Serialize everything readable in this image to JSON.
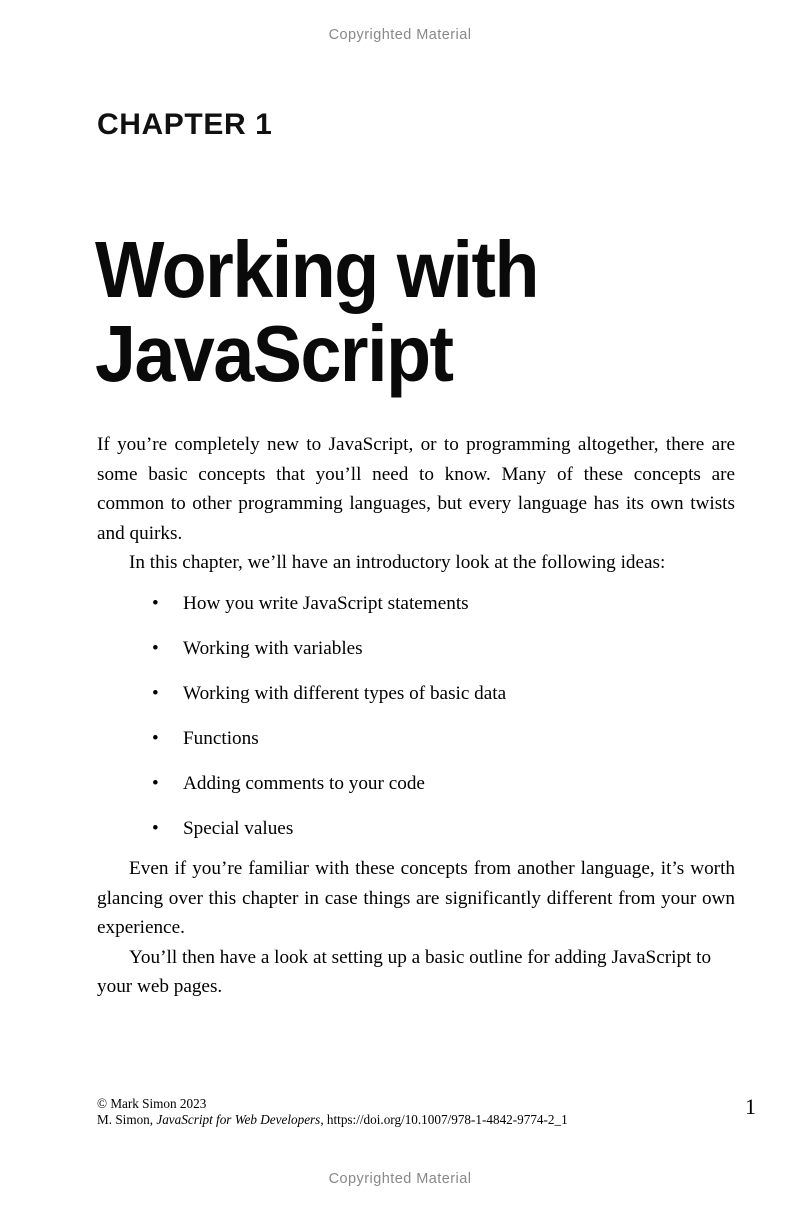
{
  "page": {
    "watermark_top": "Copyrighted Material",
    "watermark_bottom": "Copyrighted Material",
    "page_number": "1",
    "watermark_color": "#888888",
    "text_color": "#000000",
    "background_color": "#ffffff"
  },
  "chapter": {
    "label": "CHAPTER 1",
    "title_line_1": "Working with",
    "title_line_2": "JavaScript"
  },
  "body": {
    "paragraph_1": "If you’re completely new to JavaScript, or to programming altogether, there are some basic concepts that you’ll need to know. Many of these concepts are common to other programming languages, but every language has its own twists and quirks.",
    "paragraph_2": "In this chapter, we’ll have an introductory look at the following ideas:",
    "paragraph_3": "Even if you’re familiar with these concepts from another language, it’s worth glancing over this chapter in case things are significantly different from your own experience.",
    "paragraph_4": "You’ll then have a look at setting up a basic outline for adding JavaScript to your web pages.",
    "bullet_marker": "•",
    "bullets": [
      "How you write JavaScript statements",
      "Working with variables",
      "Working with different types of basic data",
      "Functions",
      "Adding comments to your code",
      "Special values"
    ]
  },
  "footer": {
    "copyright_line": "© Mark Simon 2023",
    "citation_author": "M. Simon, ",
    "citation_book_title": "JavaScript for Web Developers",
    "citation_doi": ", https://doi.org/10.1007/978-1-4842-9774-2_1"
  }
}
